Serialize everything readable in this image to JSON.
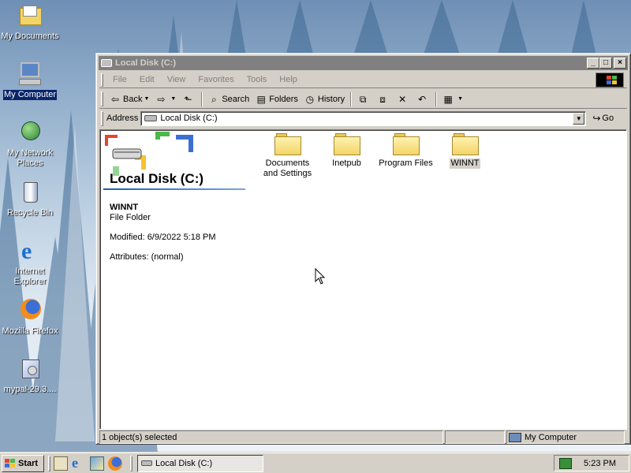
{
  "desktop": {
    "icons": [
      {
        "label": "My Documents"
      },
      {
        "label": "My Computer"
      },
      {
        "label": "My Network Places"
      },
      {
        "label": "Recycle Bin"
      },
      {
        "label": "Internet Explorer"
      },
      {
        "label": "Mozilla Firefox"
      },
      {
        "label": "mypal-29.3...."
      }
    ]
  },
  "window": {
    "title": "Local Disk (C:)",
    "buttons": {
      "minimize": "_",
      "maximize": "□",
      "close": "×"
    },
    "menu": [
      "File",
      "Edit",
      "View",
      "Favorites",
      "Tools",
      "Help"
    ],
    "toolbar": {
      "back": "Back",
      "search": "Search",
      "folders": "Folders",
      "history": "History"
    },
    "address": {
      "label": "Address",
      "value": "Local Disk (C:)",
      "go": "Go"
    },
    "info_pane": {
      "title": "Local Disk (C:)",
      "selected_name": "WINNT",
      "selected_type": "File Folder",
      "modified": "Modified: 6/9/2022 5:18 PM",
      "attributes": "Attributes: (normal)"
    },
    "items": [
      {
        "label": "Documents and Settings"
      },
      {
        "label": "Inetpub"
      },
      {
        "label": "Program Files"
      },
      {
        "label": "WINNT",
        "selected": true
      }
    ],
    "status": {
      "left": "1 object(s) selected",
      "zone": "My Computer"
    }
  },
  "taskbar": {
    "start": "Start",
    "task": "Local Disk (C:)",
    "clock": "5:23 PM"
  },
  "colors": {
    "selection": "#0a246a",
    "chrome": "#d4d0c8",
    "inactive_title": "#808080"
  }
}
